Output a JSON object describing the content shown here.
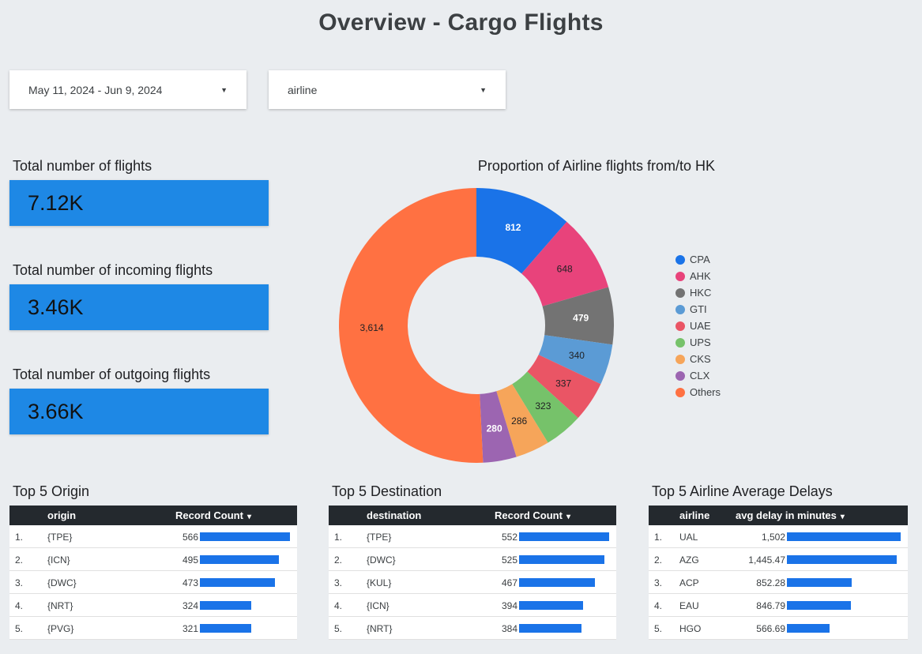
{
  "page": {
    "title": "Overview - Cargo Flights"
  },
  "controls": {
    "date_range": "May 11, 2024 - Jun 9, 2024",
    "dimension": "airline"
  },
  "kpis": [
    {
      "label": "Total number of flights",
      "value": "7.12K"
    },
    {
      "label": "Total number of incoming flights",
      "value": "3.46K"
    },
    {
      "label": "Total number of outgoing flights",
      "value": "3.66K"
    }
  ],
  "chart_data": {
    "type": "pie",
    "title": "Proportion of Airline flights from/to HK",
    "donut": true,
    "legend_position": "right",
    "slices": [
      {
        "name": "CPA",
        "value": 812,
        "label": "812",
        "color": "#1a73e8",
        "label_color": "#ffffff"
      },
      {
        "name": "AHK",
        "value": 648,
        "label": "648",
        "color": "#e8437b",
        "label_color": "#202124"
      },
      {
        "name": "HKC",
        "value": 479,
        "label": "479",
        "color": "#737373",
        "label_color": "#ffffff"
      },
      {
        "name": "GTI",
        "value": 340,
        "label": "340",
        "color": "#5b9bd5",
        "label_color": "#202124"
      },
      {
        "name": "UAE",
        "value": 337,
        "label": "337",
        "color": "#ea5565",
        "label_color": "#202124"
      },
      {
        "name": "UPS",
        "value": 323,
        "label": "323",
        "color": "#76c26a",
        "label_color": "#202124"
      },
      {
        "name": "CKS",
        "value": 286,
        "label": "286",
        "color": "#f6a55a",
        "label_color": "#202124"
      },
      {
        "name": "CLX",
        "value": 280,
        "label": "280",
        "color": "#9c65b1",
        "label_color": "#ffffff"
      },
      {
        "name": "Others",
        "value": 3614,
        "label": "3,614",
        "color": "#ff7142",
        "label_color": "#202124"
      }
    ]
  },
  "tables": [
    {
      "title": "Top 5 Origin",
      "col1": "origin",
      "col2": "Record Count",
      "sort_icon": "▾",
      "max": 566,
      "rows": [
        {
          "rank": "1.",
          "name": "{TPE}",
          "display": "566",
          "value": 566
        },
        {
          "rank": "2.",
          "name": "{ICN}",
          "display": "495",
          "value": 495
        },
        {
          "rank": "3.",
          "name": "{DWC}",
          "display": "473",
          "value": 473
        },
        {
          "rank": "4.",
          "name": "{NRT}",
          "display": "324",
          "value": 324
        },
        {
          "rank": "5.",
          "name": "{PVG}",
          "display": "321",
          "value": 321
        }
      ]
    },
    {
      "title": "Top 5 Destination",
      "col1": "destination",
      "col2": "Record Count",
      "sort_icon": "▾",
      "max": 552,
      "rows": [
        {
          "rank": "1.",
          "name": "{TPE}",
          "display": "552",
          "value": 552
        },
        {
          "rank": "2.",
          "name": "{DWC}",
          "display": "525",
          "value": 525
        },
        {
          "rank": "3.",
          "name": "{KUL}",
          "display": "467",
          "value": 467
        },
        {
          "rank": "4.",
          "name": "{ICN}",
          "display": "394",
          "value": 394
        },
        {
          "rank": "5.",
          "name": "{NRT}",
          "display": "384",
          "value": 384
        }
      ]
    },
    {
      "title": "Top 5 Airline Average Delays",
      "col1": "airline",
      "col2": "avg delay in minutes",
      "sort_icon": "▾",
      "max": 1502,
      "rows": [
        {
          "rank": "1.",
          "name": "UAL",
          "display": "1,502",
          "value": 1502
        },
        {
          "rank": "2.",
          "name": "AZG",
          "display": "1,445.47",
          "value": 1445.47
        },
        {
          "rank": "3.",
          "name": "ACP",
          "display": "852.28",
          "value": 852.28
        },
        {
          "rank": "4.",
          "name": "EAU",
          "display": "846.79",
          "value": 846.79
        },
        {
          "rank": "5.",
          "name": "HGO",
          "display": "566.69",
          "value": 566.69
        }
      ]
    }
  ]
}
